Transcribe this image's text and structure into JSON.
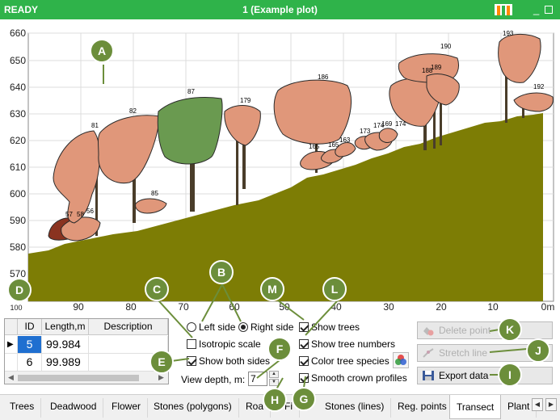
{
  "titlebar": {
    "status": "READY",
    "document": "1 (Example plot)",
    "min_glyph": "_"
  },
  "plot": {
    "y_ticks": [
      "660",
      "650",
      "640",
      "630",
      "620",
      "610",
      "600",
      "590",
      "580",
      "570"
    ],
    "x_ticks": [
      "100",
      "90",
      "80",
      "70",
      "60",
      "50",
      "40",
      "30",
      "20",
      "10",
      "0m"
    ],
    "ground_color": "#7d7d05",
    "crown_color": "#e0977a",
    "selected_crown_color": "#6a9a50",
    "tree_numbers": [
      "57",
      "58",
      "56",
      "81",
      "82",
      "85",
      "87",
      "179",
      "186",
      "165",
      "163",
      "164",
      "165",
      "173",
      "174",
      "168",
      "169",
      "174",
      "188",
      "189",
      "190",
      "193",
      "192"
    ]
  },
  "table": {
    "columns": [
      "ID",
      "Length,m",
      "Description"
    ],
    "rows": [
      {
        "id": "5",
        "length": "99.984",
        "description": ""
      },
      {
        "id": "6",
        "length": "99.989",
        "description": ""
      }
    ]
  },
  "options": {
    "left_side": "Left side",
    "right_side": "Right side",
    "isotropic": "Isotropic scale",
    "both_sides": "Show both sides",
    "view_depth_label": "View depth, m:",
    "view_depth_value": "7",
    "show_trees": "Show trees",
    "show_tree_numbers": "Show tree numbers",
    "color_species": "Color tree species",
    "smooth_crowns": "Smooth crown profiles"
  },
  "buttons": {
    "delete_point": "Delete point",
    "stretch_line": "Stretch line",
    "export_data": "Export data"
  },
  "tabs": [
    "Trees",
    "Deadwood",
    "Flower",
    "Stones (polygons)",
    "Roa",
    "Fi",
    "Stones (lines)",
    "Reg. points",
    "Transect",
    "Plant"
  ],
  "active_tab": "Transect",
  "callouts": [
    "A",
    "B",
    "C",
    "D",
    "E",
    "F",
    "G",
    "H",
    "I",
    "J",
    "K",
    "L",
    "M"
  ]
}
